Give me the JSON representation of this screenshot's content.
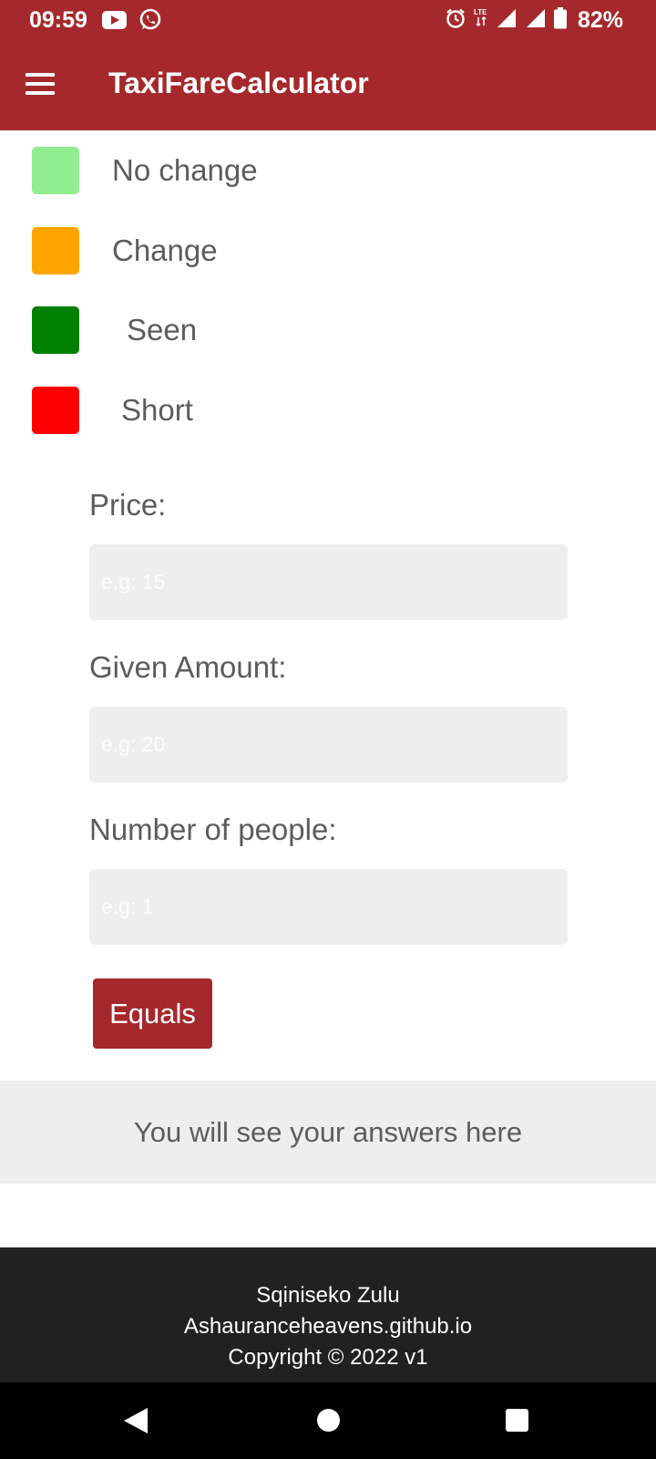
{
  "status_bar": {
    "time": "09:59",
    "battery_percent": "82%",
    "network": "LTE",
    "icons": [
      "youtube-icon",
      "whatsapp-icon",
      "alarm-icon",
      "lte-signal-icon",
      "signal-icon",
      "signal-icon",
      "battery-icon"
    ]
  },
  "app_bar": {
    "title": "TaxiFareCalculator",
    "menu_icon": "hamburger-menu-icon"
  },
  "legend": [
    {
      "label": "No change",
      "color": "#90ee90"
    },
    {
      "label": "Change",
      "color": "#ffa500"
    },
    {
      "label": "Seen",
      "color": "#008000"
    },
    {
      "label": "Short",
      "color": "#ff0000"
    }
  ],
  "form": {
    "price": {
      "label": "Price:",
      "placeholder": "e.g: 15",
      "value": ""
    },
    "given_amount": {
      "label": "Given Amount:",
      "placeholder": "e.g: 20",
      "value": ""
    },
    "people": {
      "label": "Number of people:",
      "placeholder": "e.g: 1",
      "value": ""
    },
    "submit_label": "Equals"
  },
  "answer": {
    "text": "You will see your answers here"
  },
  "footer": {
    "author": "Sqiniseko Zulu",
    "site": "Ashauranceheavens.github.io",
    "copyright": "Copyright © 2022 v1"
  },
  "colors": {
    "primary": "#a5292c",
    "footer_bg": "#212121",
    "input_bg": "#eeeeee"
  },
  "nav_bar": {
    "icons": [
      "back-icon",
      "home-icon",
      "recent-apps-icon"
    ]
  }
}
